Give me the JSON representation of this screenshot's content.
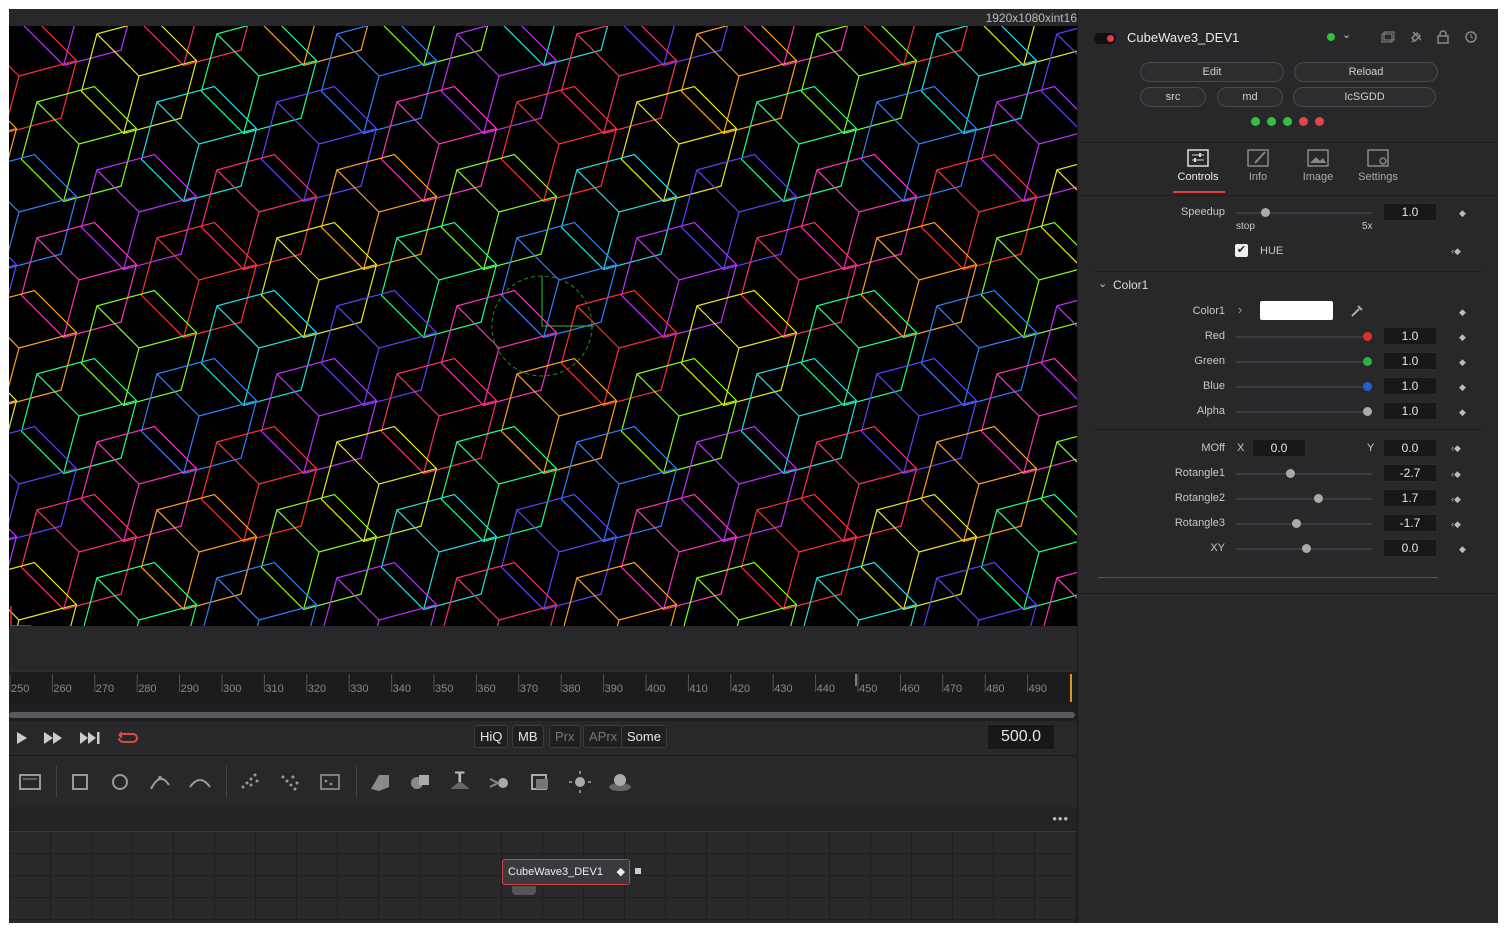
{
  "viewer": {
    "resolution": "1920x1080xint16"
  },
  "timeline": {
    "ticks": [
      "250",
      "260",
      "270",
      "280",
      "290",
      "300",
      "310",
      "320",
      "330",
      "340",
      "350",
      "360",
      "370",
      "380",
      "390",
      "400",
      "410",
      "420",
      "430",
      "440",
      "450",
      "460",
      "470",
      "480",
      "490"
    ],
    "current_frame": "500.0"
  },
  "transport": {
    "buttons": {
      "hiq": "HiQ",
      "mb": "MB",
      "prx": "Prx",
      "aprx": "APrx",
      "some": "Some"
    }
  },
  "node": {
    "name": "CubeWave3_DEV1"
  },
  "inspector": {
    "tool_name": "CubeWave3_DEV1",
    "buttons": {
      "edit": "Edit",
      "reload": "Reload",
      "src": "src",
      "md": "md",
      "icsgdd": "IcSGDD"
    },
    "status_leds": [
      "#33c040",
      "#33c040",
      "#33c040",
      "#e04848",
      "#e04848"
    ],
    "tabs": [
      {
        "label": "Controls",
        "active": true
      },
      {
        "label": "Info"
      },
      {
        "label": "Image"
      },
      {
        "label": "Settings"
      }
    ],
    "speedup": {
      "label": "Speedup",
      "value": "1.0",
      "min_label": "stop",
      "max_label": "5x"
    },
    "hue": {
      "label": "HUE",
      "checked": true
    },
    "color_section": "Color1",
    "color1_label": "Color1",
    "channels": [
      {
        "label": "Red",
        "value": "1.0",
        "color": "#e03030"
      },
      {
        "label": "Green",
        "value": "1.0",
        "color": "#30b040"
      },
      {
        "label": "Blue",
        "value": "1.0",
        "color": "#2060d0"
      },
      {
        "label": "Alpha",
        "value": "1.0",
        "color": "#aaaaaa"
      }
    ],
    "moff": {
      "label": "MOff",
      "x_label": "X",
      "x": "0.0",
      "y_label": "Y",
      "y": "0.0"
    },
    "params": [
      {
        "label": "Rotangle1",
        "value": "-2.7"
      },
      {
        "label": "Rotangle2",
        "value": "1.7"
      },
      {
        "label": "Rotangle3",
        "value": "-1.7"
      },
      {
        "label": "XY",
        "value": "0.0"
      }
    ]
  }
}
